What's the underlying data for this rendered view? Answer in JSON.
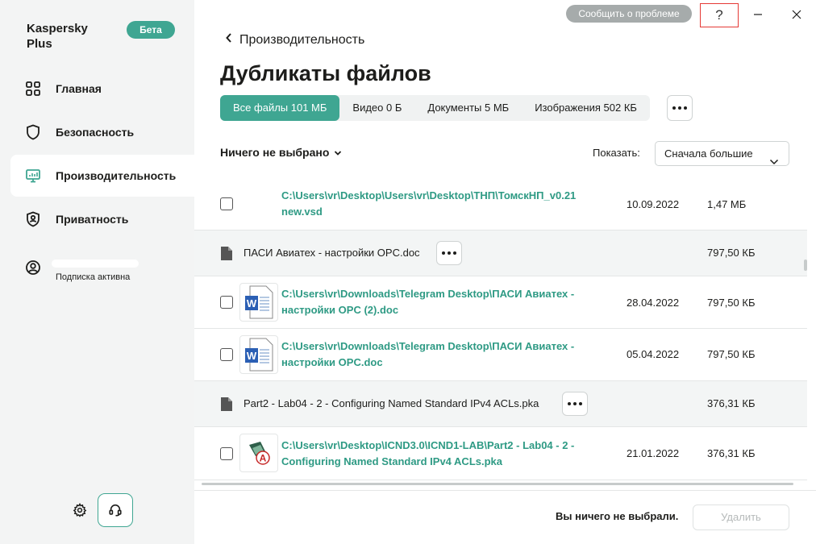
{
  "app": {
    "brand": "Kaspersky Plus",
    "badge": "Бета"
  },
  "titlebar": {
    "report_label": "Сообщить о проблеме",
    "help_label": "?"
  },
  "sidebar": {
    "items": [
      {
        "label": "Главная",
        "icon": "home-grid-icon"
      },
      {
        "label": "Безопасность",
        "icon": "shield-icon"
      },
      {
        "label": "Производительность",
        "icon": "monitor-icon"
      },
      {
        "label": "Приватность",
        "icon": "privacy-shield-icon"
      }
    ],
    "account_sub": "Подписка активна"
  },
  "main": {
    "back_label": "Производительность",
    "title": "Дубликаты файлов",
    "tabs": [
      {
        "label": "Все файлы 101 МБ",
        "active": true
      },
      {
        "label": "Видео 0 Б"
      },
      {
        "label": "Документы 5 МБ"
      },
      {
        "label": "Изображения 502 КБ"
      }
    ],
    "selection_label": "Ничего не выбрано",
    "show_label": "Показать:",
    "sort_value": "Сначала большие"
  },
  "rows": [
    {
      "path": "C:\\Users\\vr\\Desktop\\Users\\vr\\Desktop\\ТНП\\ТомскНП_v0.21 new.vsd",
      "date": "10.09.2022",
      "size": "1,47 МБ"
    },
    {
      "group": "ПАСИ Авиатех - настройки OPC.doc",
      "size": "797,50 КБ"
    },
    {
      "path": "C:\\Users\\vr\\Downloads\\Telegram Desktop\\ПАСИ Авиатех - настройки OPC (2).doc",
      "date": "28.04.2022",
      "size": "797,50 КБ"
    },
    {
      "path": "C:\\Users\\vr\\Downloads\\Telegram Desktop\\ПАСИ Авиатех - настройки OPC.doc",
      "date": "05.04.2022",
      "size": "797,50 КБ"
    },
    {
      "group": "Part2 - Lab04 - 2 - Configuring Named Standard IPv4 ACLs.pka",
      "size": "376,31 КБ"
    },
    {
      "path": "C:\\Users\\vr\\Desktop\\ICND3.0\\ICND1-LAB\\Part2 - Lab04 - 2 - Configuring Named Standard IPv4 ACLs.pka",
      "date": "21.01.2022",
      "size": "376,31 КБ"
    }
  ],
  "footer": {
    "status": "Вы ничего не выбрали.",
    "delete_label": "Удалить"
  },
  "colors": {
    "accent": "#3fa692",
    "link": "#2e9a84"
  }
}
